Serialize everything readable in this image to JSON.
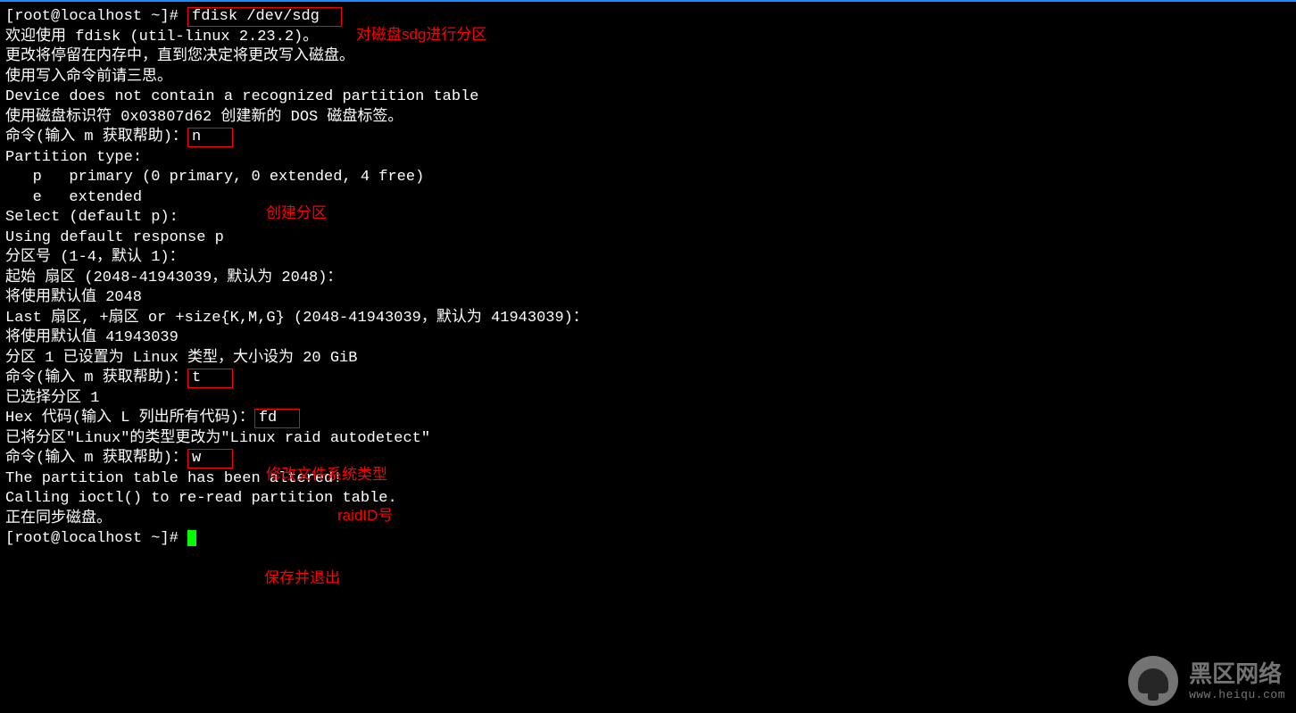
{
  "prompt1_pre": "[root@localhost ~]# ",
  "cmd_fdisk": "fdisk /dev/sdg",
  "annot_fdisk": "对磁盘sdg进行分区",
  "l_welcome": "欢迎使用 fdisk (util-linux 2.23.2)。",
  "l_blank": "",
  "l_mem": "更改将停留在内存中，直到您决定将更改写入磁盘。",
  "l_careful": "使用写入命令前请三思。",
  "l_notable": "Device does not contain a recognized partition table",
  "l_dos": "使用磁盘标识符 0x03807d62 创建新的 DOS 磁盘标签。",
  "cmd_prompt": "命令(输入 m 获取帮助)：",
  "cmd_n": "n",
  "annot_n": "创建分区",
  "l_ptype": "Partition type:",
  "l_primary": "   p   primary (0 primary, 0 extended, 4 free)",
  "l_ext": "   e   extended",
  "l_select": "Select (default p):",
  "l_default": "Using default response p",
  "l_partnum": "分区号 (1-4，默认 1)：",
  "l_start": "起始 扇区 (2048-41943039，默认为 2048)：",
  "l_use2048": "将使用默认值 2048",
  "l_last": "Last 扇区, +扇区 or +size{K,M,G} (2048-41943039，默认为 41943039)：",
  "l_use_end": "将使用默认值 41943039",
  "l_set": "分区 1 已设置为 Linux 类型，大小设为 20 GiB",
  "cmd_t": "t",
  "annot_t": "修改文件系统类型",
  "l_selected": "已选择分区 1",
  "hex_prompt": "Hex 代码(输入 L 列出所有代码)：",
  "cmd_fd": "fd",
  "annot_fd": "raidID号",
  "l_changed": "已将分区\"Linux\"的类型更改为\"Linux raid autodetect\"",
  "cmd_w": "w",
  "annot_w": "保存并退出",
  "l_altered": "The partition table has been altered!",
  "l_ioctl": "Calling ioctl() to re-read partition table.",
  "l_sync": "正在同步磁盘。",
  "prompt_end": "[root@localhost ~]# ",
  "watermark": {
    "big": "黑区网络",
    "small": "www.heiqu.com"
  }
}
